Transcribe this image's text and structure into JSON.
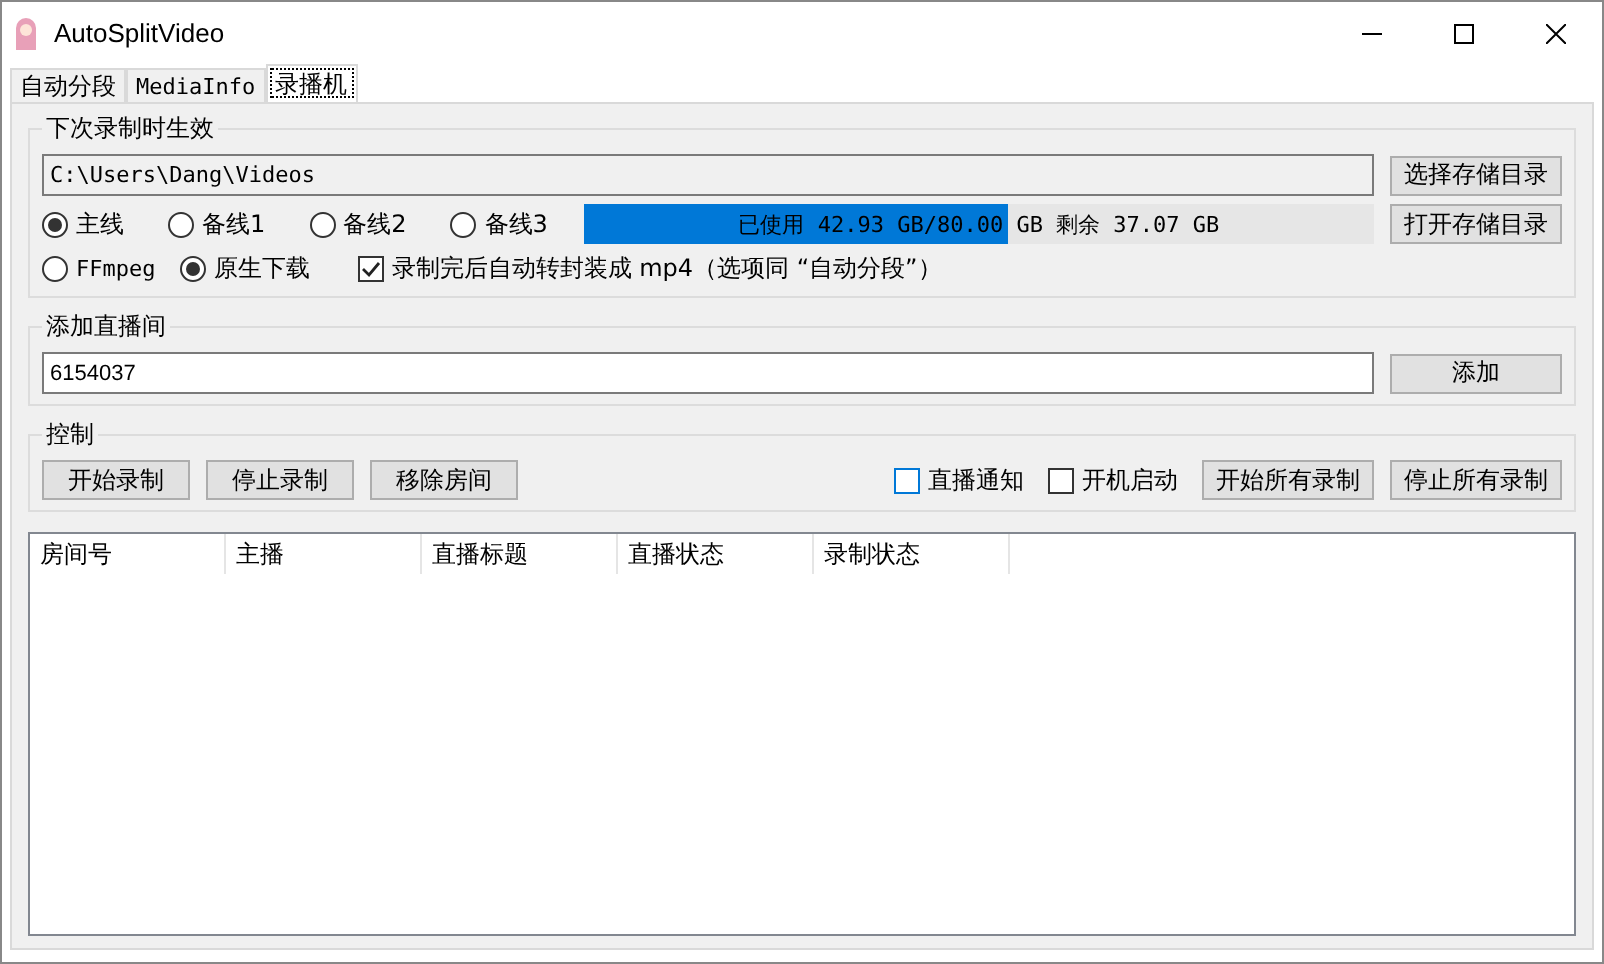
{
  "window": {
    "title": "AutoSplitVideo"
  },
  "tabs": [
    {
      "label": "自动分段",
      "selected": false
    },
    {
      "label": "MediaInfo",
      "selected": false
    },
    {
      "label": "录播机",
      "selected": true
    }
  ],
  "next_recording": {
    "title": "下次录制时生效",
    "path": "C:\\Users\\Dang\\Videos",
    "choose_button": "选择存储目录",
    "open_button": "打开存储目录",
    "lines": [
      {
        "label": "主线",
        "selected": true
      },
      {
        "label": "备线1",
        "selected": false
      },
      {
        "label": "备线2",
        "selected": false
      },
      {
        "label": "备线3",
        "selected": false
      }
    ],
    "disk": {
      "level": 0.537,
      "reading": "已使用 42.93 GB/80.00 GB 剩余 37.07 GB"
    },
    "methods": [
      {
        "label": "FFmpeg",
        "selected": false
      },
      {
        "label": "原生下载",
        "selected": true
      }
    ],
    "remux": {
      "label": "录制完后自动转封装成 mp4（选项同 “自动分段”）",
      "checked": true
    }
  },
  "add_room": {
    "title": "添加直播间",
    "value": "6154037",
    "button": "添加"
  },
  "control": {
    "title": "控制",
    "buttons": [
      "开始录制",
      "停止录制",
      "移除房间"
    ],
    "options": [
      {
        "label": "直播通知",
        "checked": false,
        "focused": true
      },
      {
        "label": "开机启动",
        "checked": false,
        "focused": false
      }
    ],
    "right_buttons": [
      "开始所有录制",
      "停止所有录制"
    ]
  },
  "table": {
    "columns": [
      "房间号",
      "主播",
      "直播标题",
      "直播状态",
      "录制状态"
    ]
  }
}
